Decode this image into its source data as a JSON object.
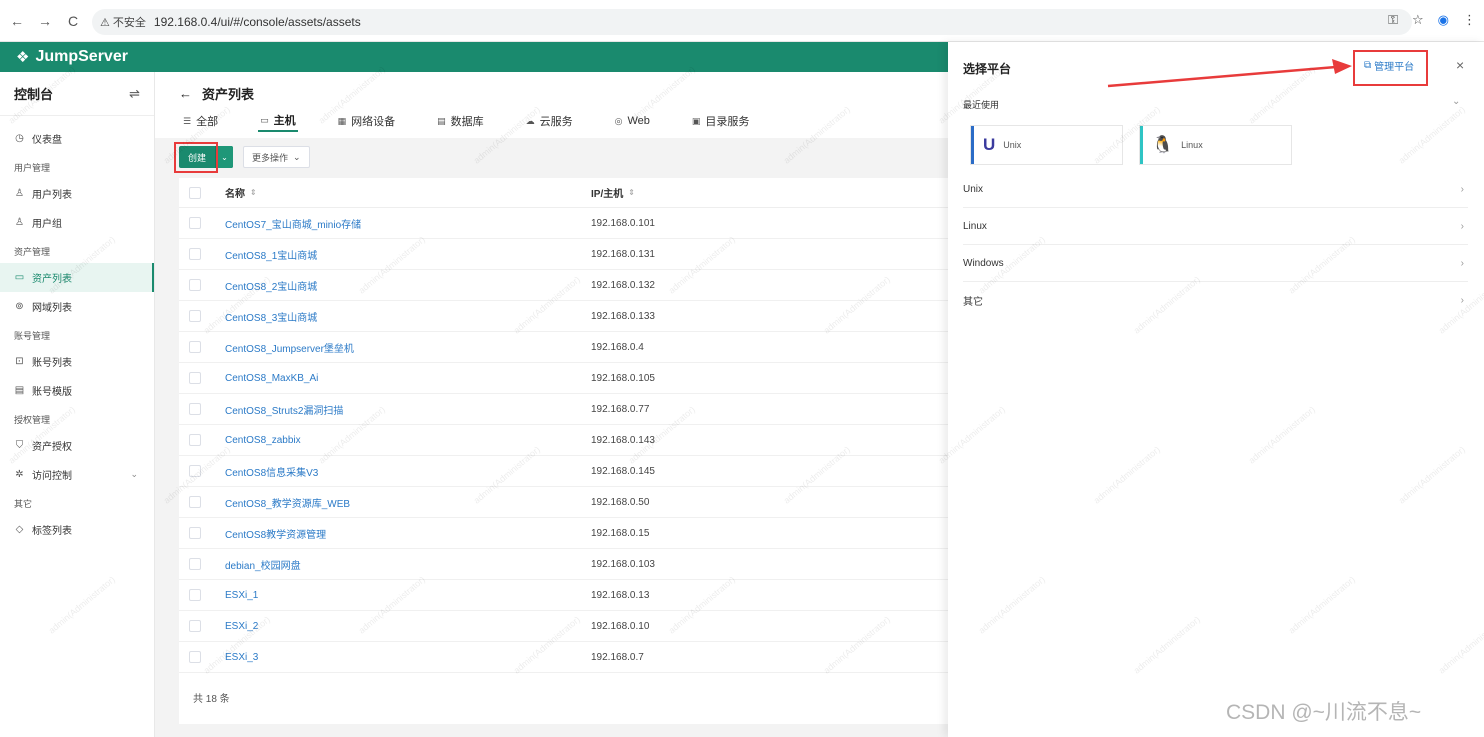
{
  "browser": {
    "back": "←",
    "forward": "→",
    "reload": "C",
    "insecure_label": "⚠ 不安全",
    "url": "192.168.0.4/ui/#/console/assets/assets"
  },
  "app": {
    "logo": "JumpServer"
  },
  "sidebar": {
    "title": "控制台",
    "items": {
      "dashboard": "仪表盘",
      "group_users": "用户管理",
      "user_list": "用户列表",
      "user_group": "用户组",
      "group_assets": "资产管理",
      "asset_list": "资产列表",
      "domain_list": "网域列表",
      "group_accounts": "账号管理",
      "account_list": "账号列表",
      "account_template": "账号模版",
      "group_perms": "授权管理",
      "asset_perm": "资产授权",
      "access_control": "访问控制",
      "group_other": "其它",
      "label_list": "标签列表"
    }
  },
  "page": {
    "back": "←",
    "title": "资产列表",
    "tabs": [
      "全部",
      "主机",
      "网络设备",
      "数据库",
      "云服务",
      "Web",
      "目录服务"
    ],
    "create_label": "创建",
    "more_label": "更多操作",
    "col_name": "名称",
    "col_ip": "IP/主机",
    "footer": "共 18 条"
  },
  "assets": [
    {
      "name": "CentOS7_宝山商城_minio存储",
      "ip": "192.168.0.101"
    },
    {
      "name": "CentOS8_1宝山商城",
      "ip": "192.168.0.131"
    },
    {
      "name": "CentOS8_2宝山商城",
      "ip": "192.168.0.132"
    },
    {
      "name": "CentOS8_3宝山商城",
      "ip": "192.168.0.133"
    },
    {
      "name": "CentOS8_Jumpserver堡垒机",
      "ip": "192.168.0.4"
    },
    {
      "name": "CentOS8_MaxKB_Ai",
      "ip": "192.168.0.105"
    },
    {
      "name": "CentOS8_Struts2漏洞扫描",
      "ip": "192.168.0.77"
    },
    {
      "name": "CentOS8_zabbix",
      "ip": "192.168.0.143"
    },
    {
      "name": "CentOS8信息采集V3",
      "ip": "192.168.0.145"
    },
    {
      "name": "CentOS8_教学资源库_WEB",
      "ip": "192.168.0.50"
    },
    {
      "name": "CentOS8教学资源管理",
      "ip": "192.168.0.15"
    },
    {
      "name": "debian_校园网盘",
      "ip": "192.168.0.103"
    },
    {
      "name": "ESXi_1",
      "ip": "192.168.0.13"
    },
    {
      "name": "ESXi_2",
      "ip": "192.168.0.10"
    },
    {
      "name": "ESXi_3",
      "ip": "192.168.0.7"
    }
  ],
  "drawer": {
    "title": "选择平台",
    "manage": "管理平台",
    "close": "×",
    "recent": "最近使用",
    "recent_platforms": [
      {
        "name": "Unix",
        "color": "#2b6cc7"
      },
      {
        "name": "Linux",
        "color": "#2ec4c4"
      }
    ],
    "categories": [
      "Unix",
      "Linux",
      "Windows",
      "其它"
    ]
  },
  "watermark": "admin(Administrator)",
  "csdn": "CSDN @~川流不息~"
}
